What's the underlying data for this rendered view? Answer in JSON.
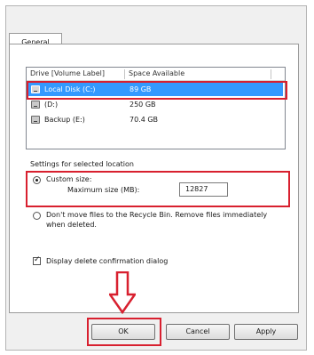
{
  "tab": {
    "label": "General"
  },
  "drive_list": {
    "columns": [
      "Drive [Volume Label]",
      "Space Available"
    ],
    "rows": [
      {
        "drive": "Local Disk (C:)",
        "space": "89 GB",
        "selected": true
      },
      {
        "drive": "(D:)",
        "space": "250 GB",
        "selected": false
      },
      {
        "drive": "Backup (E:)",
        "space": "70.4 GB",
        "selected": false
      }
    ]
  },
  "settings": {
    "group_label": "Settings for selected location",
    "custom_size_label": "Custom size:",
    "max_size_label": "Maximum size (MB):",
    "max_size_value": "12827",
    "dont_move_label": "Don't move files to the Recycle Bin. Remove files immediately when deleted.",
    "confirm_label": "Display delete confirmation dialog"
  },
  "buttons": {
    "ok": "OK",
    "cancel": "Cancel",
    "apply": "Apply"
  },
  "colors": {
    "highlight": "#d8202f",
    "selection": "#3399ff"
  }
}
